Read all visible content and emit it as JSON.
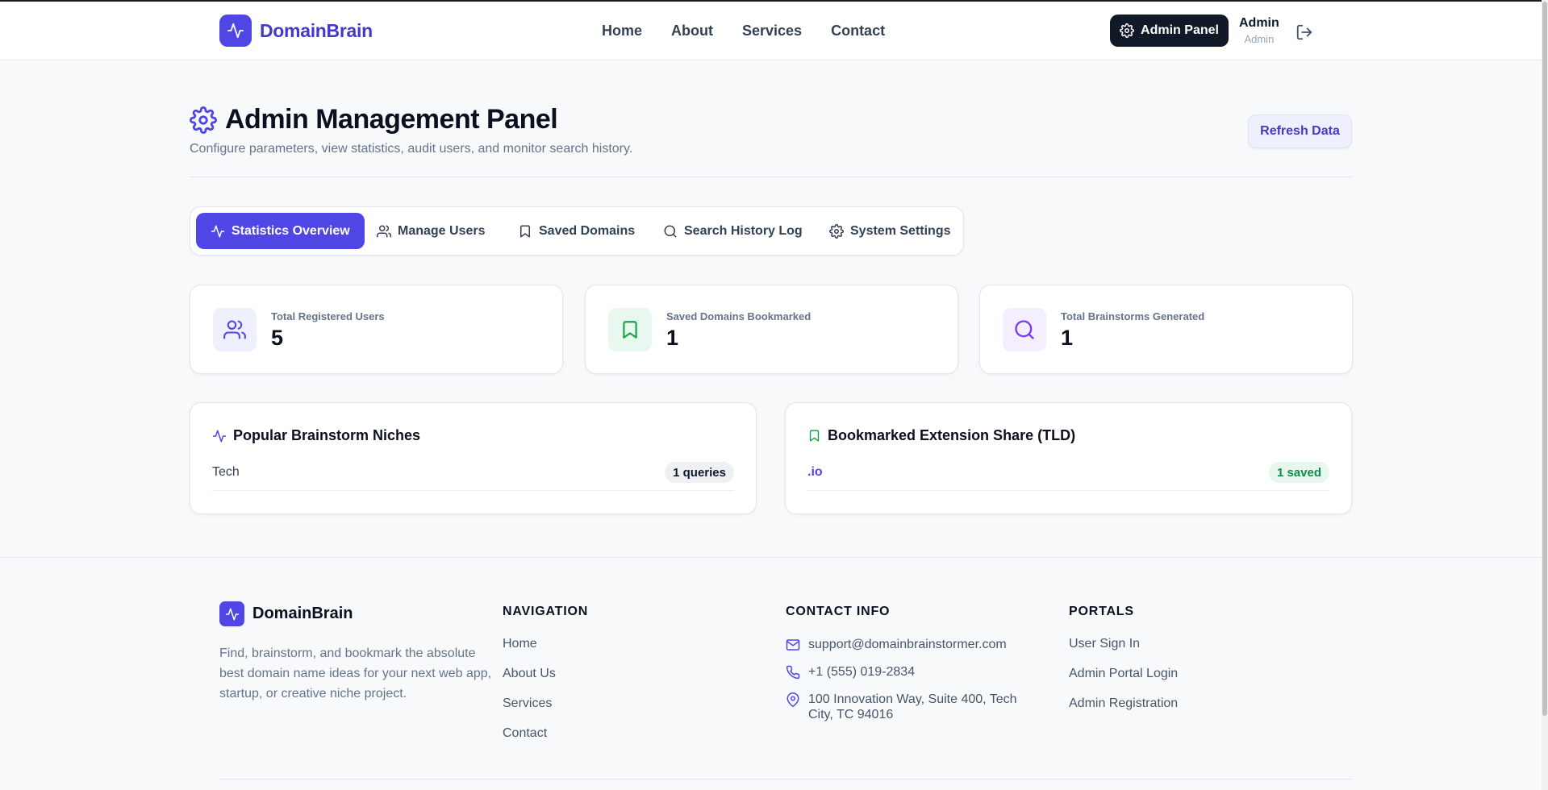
{
  "brand": {
    "name": "DomainBrain",
    "accent": "#4f46e5"
  },
  "nav": {
    "items": [
      "Home",
      "About",
      "Services",
      "Contact"
    ]
  },
  "header": {
    "admin_button": "Admin Panel",
    "user_name": "Admin",
    "user_role": "Admin"
  },
  "page": {
    "title": "Admin Management Panel",
    "subtitle": "Configure parameters, view statistics, audit users, and monitor search history.",
    "refresh_label": "Refresh Data"
  },
  "tabs": [
    {
      "label": "Statistics Overview",
      "icon": "activity-icon",
      "active": true
    },
    {
      "label": "Manage Users",
      "icon": "users-icon",
      "active": false
    },
    {
      "label": "Saved Domains",
      "icon": "bookmark-icon",
      "active": false
    },
    {
      "label": "Search History Log",
      "icon": "search-icon",
      "active": false
    },
    {
      "label": "System Settings",
      "icon": "gear-icon",
      "active": false
    }
  ],
  "stats": [
    {
      "label": "Total Registered Users",
      "value": "5",
      "icon": "users-icon",
      "color": "#4f46e5"
    },
    {
      "label": "Saved Domains Bookmarked",
      "value": "1",
      "icon": "bookmark-icon",
      "color": "#16a34a"
    },
    {
      "label": "Total Brainstorms Generated",
      "value": "1",
      "icon": "search-icon",
      "color": "#7c3aed"
    }
  ],
  "niches": {
    "title": "Popular Brainstorm Niches",
    "rows": [
      {
        "label": "Tech",
        "badge": "1 queries"
      }
    ]
  },
  "tld_share": {
    "title": "Bookmarked Extension Share (TLD)",
    "rows": [
      {
        "label": ".io",
        "badge": "1 saved"
      }
    ]
  },
  "footer": {
    "brand": "DomainBrain",
    "description": "Find, brainstorm, and bookmark the absolute best domain name ideas for your next web app, startup, or creative niche project.",
    "navigation": {
      "heading": "NAVIGATION",
      "links": [
        "Home",
        "About Us",
        "Services",
        "Contact"
      ]
    },
    "contact": {
      "heading": "CONTACT INFO",
      "email": "support@domainbrainstormer.com",
      "phone": "+1 (555) 019-2834",
      "address": "100 Innovation Way, Suite 400, Tech City, TC 94016"
    },
    "portals": {
      "heading": "PORTALS",
      "links": [
        "User Sign In",
        "Admin Portal Login",
        "Admin Registration"
      ]
    }
  }
}
